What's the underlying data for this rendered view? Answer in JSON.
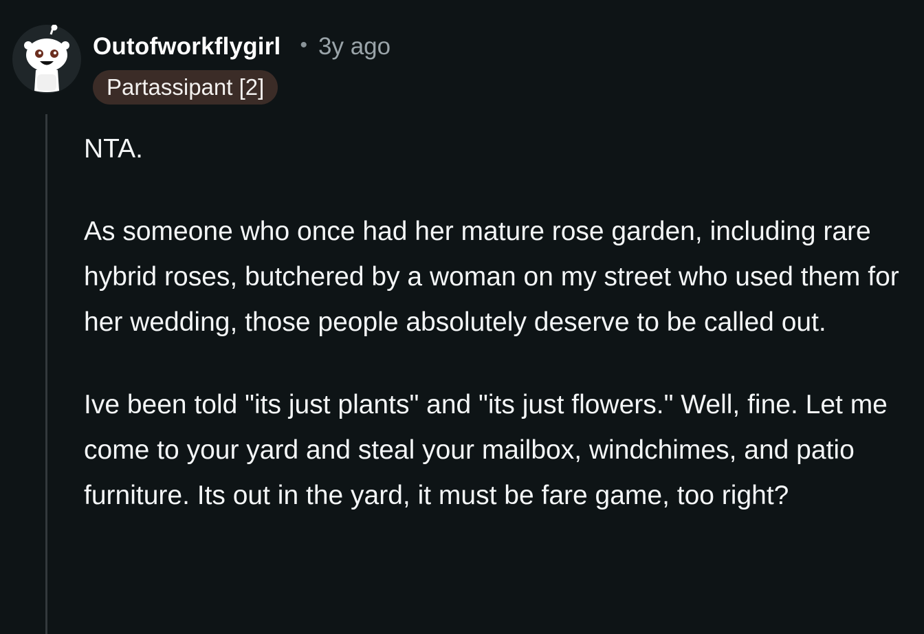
{
  "comment": {
    "author": "Outofworkflygirl",
    "separator": "•",
    "timestamp": "3y ago",
    "flair": "Partassipant [2]",
    "paragraphs": [
      {
        "lines": [
          "NTA."
        ]
      },
      {
        "lines": [
          "As someone who once had her mature rose garden,",
          "including rare hybrid roses, butchered by a woman on",
          "my street who used them for her wedding, those",
          "people absolutely deserve to be called out."
        ]
      },
      {
        "lines": [
          "Ive been told \"its just plants\" and \"its just flowers.\"",
          "Well, fine. Let me come to your yard and steal your",
          "mailbox, windchimes, and patio furniture. Its out in the",
          "yard, it must be fare game, too right?"
        ]
      }
    ]
  },
  "colors": {
    "background": "#0e1416",
    "flair_background": "#3b2c27",
    "meta_text": "#9aa4a9",
    "thread_line": "#33393c"
  },
  "icons": {
    "avatar": "snoo-avatar-icon"
  }
}
